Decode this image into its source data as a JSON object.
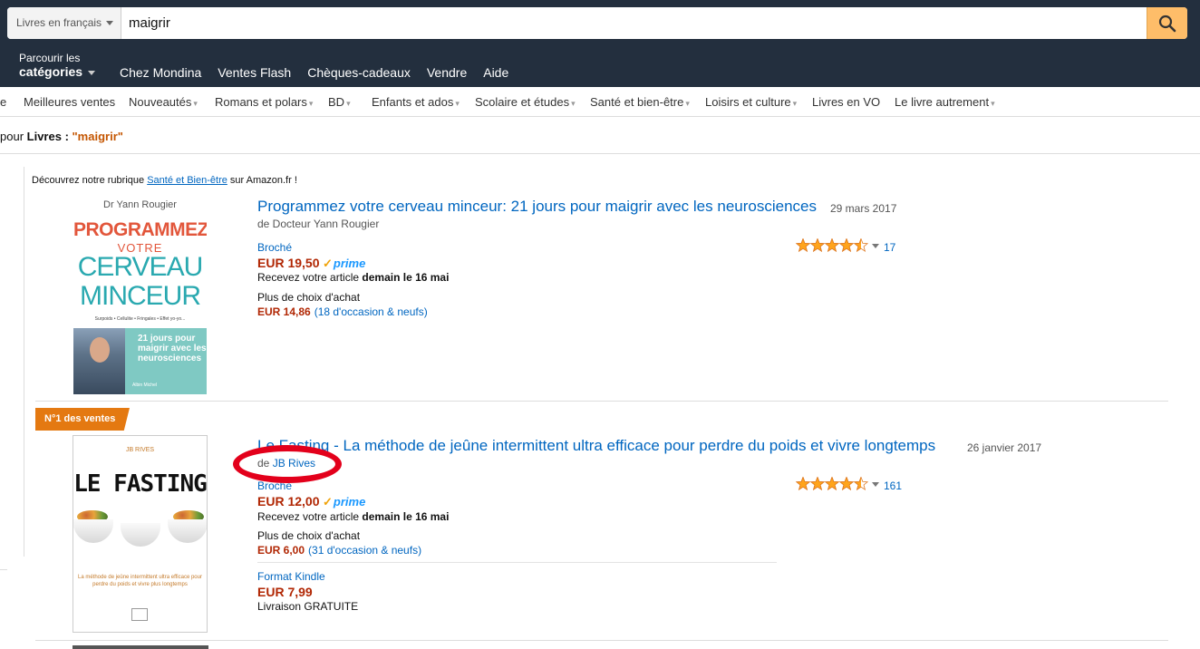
{
  "search": {
    "category": "Livres en français",
    "query": "maigrir"
  },
  "header": {
    "browse_line1": "Parcourir les",
    "browse_line2": "catégories",
    "nav": [
      "Chez Mondina",
      "Ventes Flash",
      "Chèques-cadeaux",
      "Vendre",
      "Aide"
    ]
  },
  "subnav": {
    "stub": "e",
    "items": [
      {
        "label": "Meilleures ventes",
        "dropdown": false
      },
      {
        "label": "Nouveautés",
        "dropdown": true
      },
      {
        "label": "Romans et polars",
        "dropdown": true
      },
      {
        "label": "BD",
        "dropdown": true
      },
      {
        "label": "Enfants et ados",
        "dropdown": true
      },
      {
        "label": "Scolaire et études",
        "dropdown": true
      },
      {
        "label": "Santé et bien-être",
        "dropdown": true
      },
      {
        "label": "Loisirs et culture",
        "dropdown": true
      },
      {
        "label": "Livres en VO",
        "dropdown": false
      },
      {
        "label": "Le livre autrement",
        "dropdown": true
      }
    ]
  },
  "results": {
    "prefix": "pour ",
    "category": "Livres",
    "separator": " : ",
    "keyword": "\"maigrir\""
  },
  "promo": {
    "before": "Découvrez notre rubrique ",
    "link": "Santé et Bien-être",
    "after": " sur Amazon.fr !"
  },
  "products": [
    {
      "title": "Programmez votre cerveau minceur: 21 jours pour maigrir avec les neurosciences",
      "date": "29 mars 2017",
      "by_prefix": "de Docteur Yann Rougier",
      "format": "Broché",
      "price": "EUR 19,50",
      "prime": "prime",
      "delivery_prefix": "Recevez votre article ",
      "delivery_bold": "demain le 16 mai",
      "more_choices": "Plus de choix d'achat",
      "used_price": "EUR 14,86",
      "used_offers": "(18 d'occasion & neufs)",
      "rating": 4.5,
      "review_count": "17",
      "cover": {
        "author": "Dr Yann Rougier",
        "line1": "PROGRAMMEZ",
        "line2": "VOTRE",
        "line3": "CERVEAU",
        "line4": "MINCEUR",
        "tagline": "Surpoids • Cellulite • Fringales • Effet yo-yo...",
        "box": "21 jours pour maigrir avec les neurosciences",
        "publisher": "Albin Michel"
      }
    },
    {
      "badge": "N°1 des ventes",
      "title": "Le Fasting - La méthode de jeûne intermittent ultra efficace pour perdre du poids et vivre longtemps",
      "date": "26 janvier 2017",
      "by_prefix": "de ",
      "author_link": "JB Rives",
      "format": "Broché",
      "price": "EUR 12,00",
      "prime": "prime",
      "delivery_prefix": "Recevez votre article ",
      "delivery_bold": "demain le 16 mai",
      "more_choices": "Plus de choix d'achat",
      "used_price": "EUR 6,00",
      "used_offers": "(31 d'occasion & neufs)",
      "kindle_format": "Format Kindle",
      "kindle_price": "EUR 7,99",
      "kindle_delivery": "Livraison GRATUITE",
      "rating": 4.5,
      "review_count": "161",
      "cover": {
        "author": "JB RIVES",
        "title": "LE FASTING",
        "subtitle": "La méthode de jeûne intermittent ultra efficace pour perdre du poids et vivre plus longtemps"
      }
    }
  ],
  "colors": {
    "header_bg": "#232f3e",
    "search_button": "#febd69",
    "link": "#0066c0",
    "price": "#b12704",
    "badge": "#e47911",
    "annotation_circle": "#e3001b",
    "star": "#ffa41c"
  }
}
